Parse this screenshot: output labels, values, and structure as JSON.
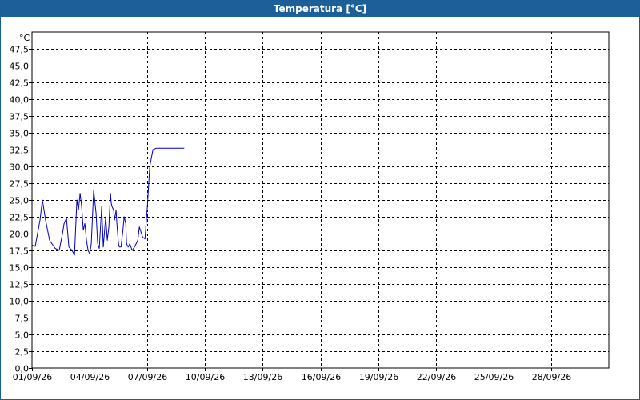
{
  "window": {
    "title": "Temperatura [°C]"
  },
  "colors": {
    "titlebar": "#1d5f99",
    "series": "#0000c0",
    "grid": "#000000"
  },
  "chart_data": {
    "type": "line",
    "title": "Temperatura [°C]",
    "ylabel": "°C",
    "xlabel": "",
    "ylim": [
      0,
      50
    ],
    "yticks": [
      0,
      2.5,
      5,
      7.5,
      10,
      12.5,
      15,
      17.5,
      20,
      22.5,
      25,
      27.5,
      30,
      32.5,
      35,
      37.5,
      40,
      42.5,
      45,
      47.5
    ],
    "ytick_labels": [
      "0,0",
      "2,5",
      "5,0",
      "7,5",
      "10,0",
      "12,5",
      "15,0",
      "17,5",
      "20,0",
      "22,5",
      "25,0",
      "27,5",
      "30,0",
      "32,5",
      "35,0",
      "37,5",
      "40,0",
      "42,5",
      "45,0",
      "47,5"
    ],
    "xlim": [
      "2026-09-01",
      "2026-10-01"
    ],
    "xtick_labels": [
      "01/09/26",
      "04/09/26",
      "07/09/26",
      "10/09/26",
      "13/09/26",
      "16/09/26",
      "19/09/26",
      "22/09/26",
      "25/09/26",
      "28/09/26"
    ],
    "grid": true,
    "series": [
      {
        "x": [
          "2026-09-01 00:00",
          "2026-09-01 04:00",
          "2026-09-01 10:00",
          "2026-09-01 13:00",
          "2026-09-01 17:00",
          "2026-09-01 22:00",
          "2026-09-02 05:00",
          "2026-09-02 10:00",
          "2026-09-02 14:00",
          "2026-09-02 16:00",
          "2026-09-02 19:00",
          "2026-09-02 22:00",
          "2026-09-03 02:00",
          "2026-09-03 05:00",
          "2026-09-03 08:00",
          "2026-09-03 10:00",
          "2026-09-03 12:00",
          "2026-09-03 14:00",
          "2026-09-03 16:00",
          "2026-09-03 18:00",
          "2026-09-03 20:00",
          "2026-09-03 22:00",
          "2026-09-04 00:00",
          "2026-09-04 02:00",
          "2026-09-04 05:00",
          "2026-09-04 08:00",
          "2026-09-04 10:00",
          "2026-09-04 12:00",
          "2026-09-04 15:00",
          "2026-09-04 17:00",
          "2026-09-04 20:00",
          "2026-09-04 22:00",
          "2026-09-05 00:00",
          "2026-09-05 02:00",
          "2026-09-05 03:00",
          "2026-09-05 04:00",
          "2026-09-05 06:00",
          "2026-09-05 07:00",
          "2026-09-05 09:00",
          "2026-09-05 10:00",
          "2026-09-05 12:00",
          "2026-09-05 13:00",
          "2026-09-05 15:00",
          "2026-09-05 17:00",
          "2026-09-05 19:00",
          "2026-09-05 21:00",
          "2026-09-05 22:00",
          "2026-09-06 00:00",
          "2026-09-06 02:00",
          "2026-09-06 05:00",
          "2026-09-06 08:00",
          "2026-09-06 12:00",
          "2026-09-06 14:00",
          "2026-09-06 18:00",
          "2026-09-06 21:00",
          "2026-09-07 00:00",
          "2026-09-07 03:00",
          "2026-09-07 07:00",
          "2026-09-07 11:00",
          "2026-09-07 14:00",
          "2026-09-07 17:00",
          "2026-09-07 22:00",
          "2026-09-08 04:00",
          "2026-09-08 10:00",
          "2026-09-08 13:00",
          "2026-09-08 16:00",
          "2026-09-08 19:00",
          "2026-09-08 22:00"
        ],
        "y": [
          18.3,
          18.1,
          22.0,
          25.0,
          22.0,
          19.0,
          17.8,
          17.5,
          20.0,
          21.5,
          22.3,
          18.0,
          17.5,
          16.8,
          25.0,
          23.5,
          26.0,
          24.0,
          20.5,
          21.5,
          19.0,
          17.5,
          17.0,
          18.5,
          26.5,
          23.0,
          18.5,
          17.8,
          24.0,
          18.0,
          22.5,
          19.0,
          21.0,
          26.0,
          24.5,
          24.0,
          23.5,
          22.0,
          23.5,
          21.5,
          18.5,
          18.0,
          18.0,
          20.0,
          22.5,
          21.5,
          18.5,
          18.0,
          18.5,
          17.5,
          18.0,
          19.0,
          21.0,
          19.5,
          19.2,
          24.0,
          30.0,
          32.5,
          32.7,
          32.7,
          32.7,
          32.7,
          32.7,
          32.7,
          32.7,
          32.7,
          32.7,
          32.7
        ]
      }
    ]
  }
}
